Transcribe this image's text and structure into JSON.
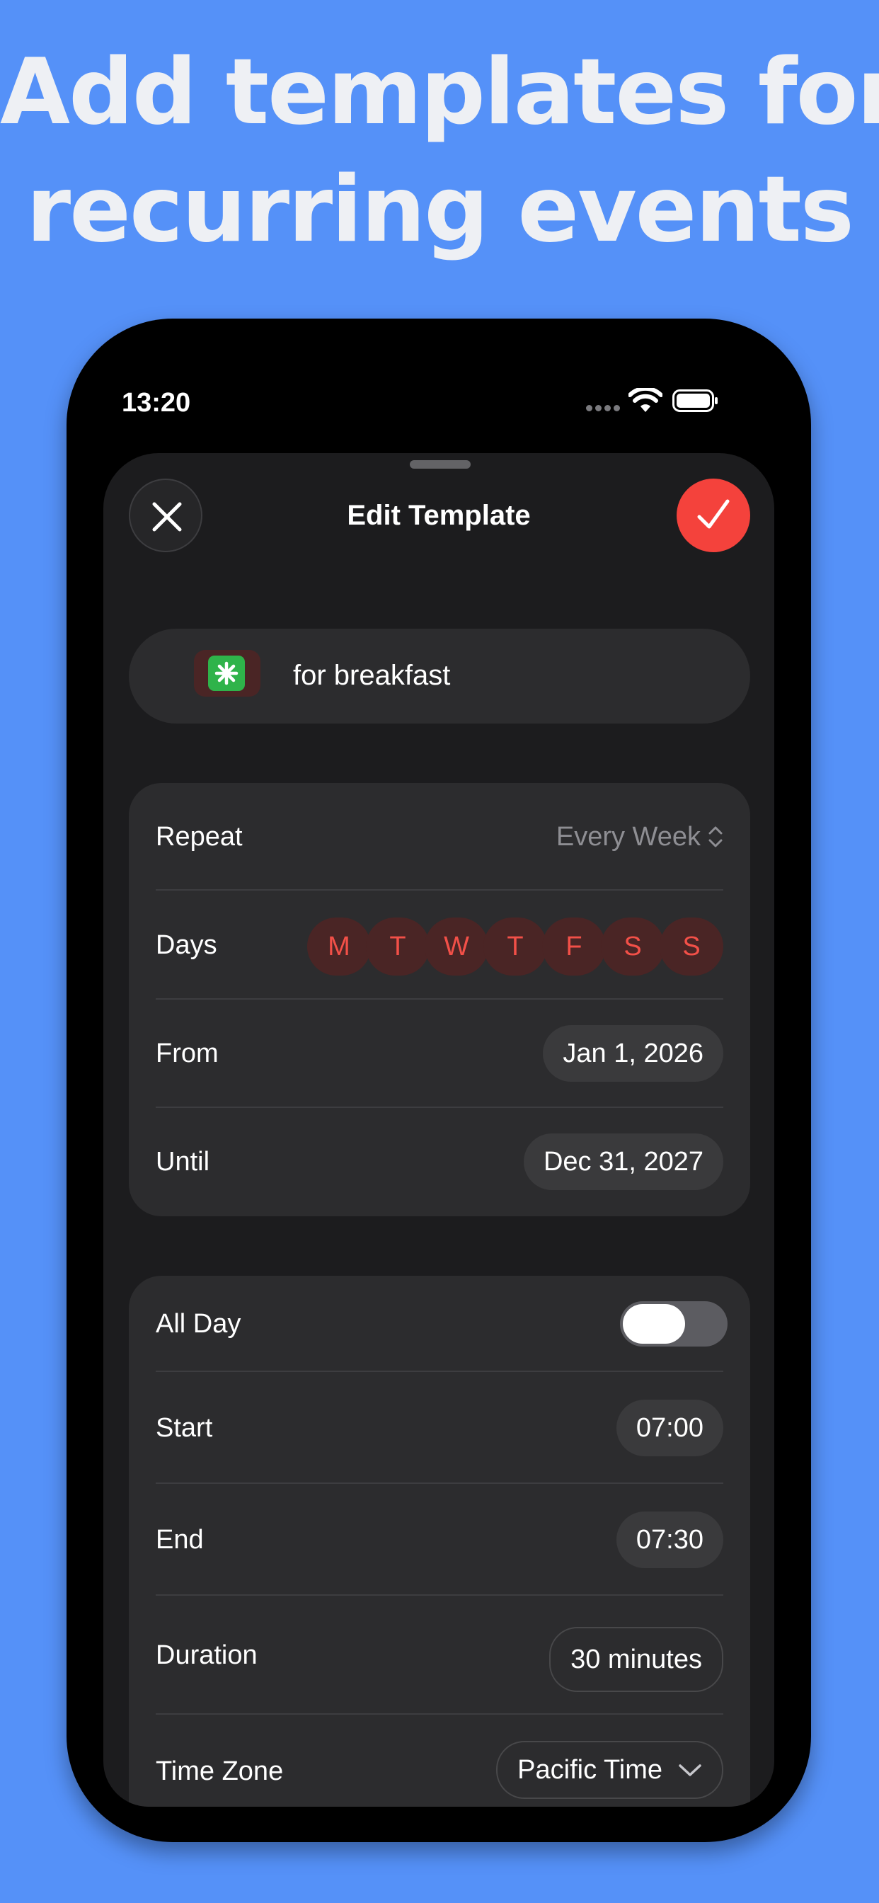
{
  "headline": {
    "line1": "Add templates for",
    "line2": "recurring events"
  },
  "status_bar": {
    "time": "13:20"
  },
  "sheet": {
    "title": "Edit Template"
  },
  "template": {
    "name": "for breakfast"
  },
  "schedule": {
    "repeat_label": "Repeat",
    "repeat_value": "Every Week",
    "days_label": "Days",
    "days": [
      "M",
      "T",
      "W",
      "T",
      "F",
      "S",
      "S"
    ],
    "from_label": "From",
    "from_value": "Jan 1, 2026",
    "until_label": "Until",
    "until_value": "Dec 31, 2027"
  },
  "timing": {
    "all_day_label": "All Day",
    "start_label": "Start",
    "start_value": "07:00",
    "end_label": "End",
    "end_value": "07:30",
    "duration_label": "Duration",
    "duration_value": "30 minutes",
    "timezone_label": "Time Zone",
    "timezone_value": "Pacific Time"
  },
  "colors": {
    "background": "#5591f8",
    "accent": "#f4423c",
    "day_text": "#f25048",
    "card": "#2c2c2e"
  }
}
